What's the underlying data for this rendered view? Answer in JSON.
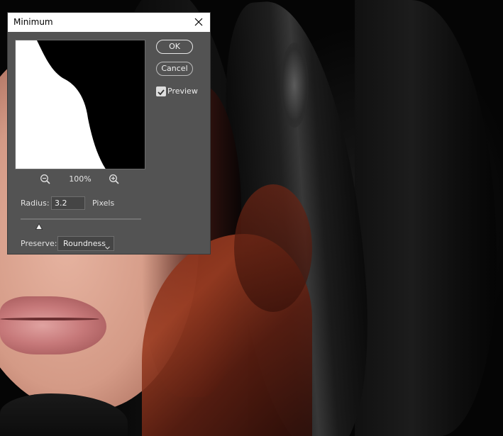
{
  "dialog": {
    "title": "Minimum",
    "ok_label": "OK",
    "cancel_label": "Cancel",
    "preview_label": "Preview",
    "preview_checked": true,
    "zoom_level": "100%",
    "radius_label": "Radius:",
    "radius_value": "3.2",
    "radius_unit": "Pixels",
    "slider_fraction": 0.15,
    "preserve_label": "Preserve:",
    "preserve_value": "Roundness"
  },
  "icons": {
    "close": "close-icon",
    "zoom_out": "zoom-out-icon",
    "zoom_in": "zoom-in-icon",
    "check": "checkmark-icon",
    "dropdown": "chevron-down-icon"
  },
  "colors": {
    "dialog_bg": "#535353",
    "titlebar_bg": "#ffffff",
    "text_light": "#e6e6e6"
  }
}
